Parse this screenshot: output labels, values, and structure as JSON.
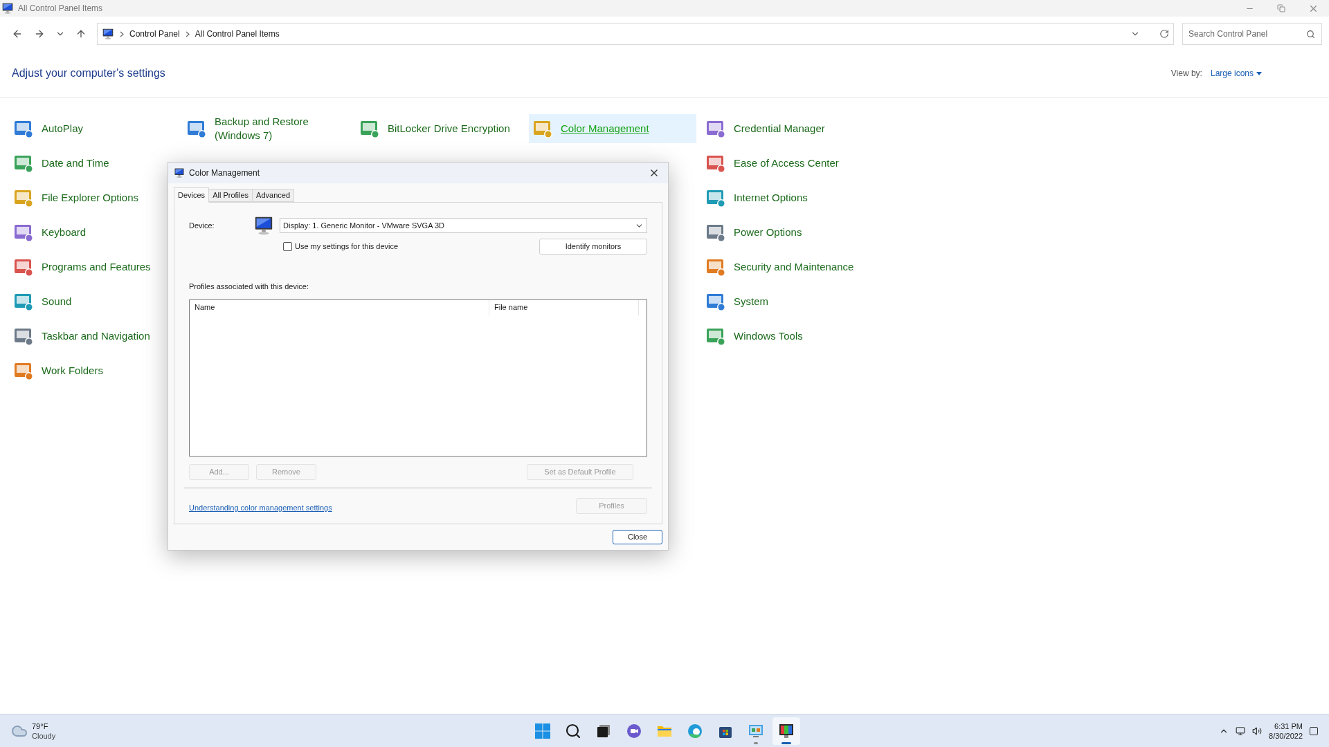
{
  "window": {
    "title": "All Control Panel Items"
  },
  "nav": {
    "breadcrumbs": [
      "Control Panel",
      "All Control Panel Items"
    ],
    "search": {
      "placeholder": "Search Control Panel"
    }
  },
  "heading": "Adjust your computer's settings",
  "view_by": {
    "label": "View by:",
    "value": "Large icons"
  },
  "columns": [
    [
      {
        "label": "AutoPlay",
        "selected": false
      },
      {
        "label": "Date and Time",
        "selected": false
      },
      {
        "label": "File Explorer Options",
        "selected": false
      },
      {
        "label": "Keyboard",
        "selected": false
      },
      {
        "label": "Programs and Features",
        "selected": false
      },
      {
        "label": "Sound",
        "selected": false
      },
      {
        "label": "Taskbar and Navigation",
        "selected": false
      },
      {
        "label": "Work Folders",
        "selected": false
      }
    ],
    [
      {
        "label": "Backup and Restore (Windows 7)",
        "selected": false
      }
    ],
    [
      {
        "label": "BitLocker Drive Encryption",
        "selected": false
      }
    ],
    [
      {
        "label": "Color Management",
        "selected": true
      }
    ],
    [
      {
        "label": "Credential Manager",
        "selected": false
      },
      {
        "label": "Ease of Access Center",
        "selected": false
      },
      {
        "label": "Internet Options",
        "selected": false
      },
      {
        "label": "Power Options",
        "selected": false
      },
      {
        "label": "Security and Maintenance",
        "selected": false
      },
      {
        "label": "System",
        "selected": false
      },
      {
        "label": "Windows Tools",
        "selected": false
      }
    ]
  ],
  "dialog": {
    "title": "Color Management",
    "tabs": [
      {
        "label": "Devices",
        "selected": true
      },
      {
        "label": "All Profiles",
        "selected": false
      },
      {
        "label": "Advanced",
        "selected": false
      }
    ],
    "device_label": "Device:",
    "device_value": "Display: 1. Generic Monitor - VMware SVGA 3D",
    "use_my_settings": {
      "label": "Use my settings for this device",
      "checked": false
    },
    "identify_button": "Identify monitors",
    "profiles_label": "Profiles associated with this device:",
    "table": {
      "columns": [
        "Name",
        "File name"
      ]
    },
    "buttons": [
      {
        "label": "Add...",
        "disabled": true
      },
      {
        "label": "Remove",
        "disabled": true
      },
      {
        "label": "Set as Default Profile",
        "disabled": true
      }
    ],
    "link": "Understanding color management settings",
    "profiles_button": {
      "label": "Profiles",
      "disabled": true
    },
    "close_button": "Close"
  },
  "taskbar": {
    "weather": {
      "temperature": "79°F",
      "condition": "Cloudy"
    },
    "apps": [
      {
        "kind": "start",
        "selected": false
      },
      {
        "kind": "search",
        "selected": false
      },
      {
        "kind": "taskview",
        "selected": false
      },
      {
        "kind": "chat",
        "selected": false
      },
      {
        "kind": "explorer",
        "selected": false
      },
      {
        "kind": "edge",
        "selected": false
      },
      {
        "kind": "store",
        "selected": false
      },
      {
        "kind": "controlpanel",
        "selected": false,
        "running": true
      },
      {
        "kind": "colormgmt",
        "selected": true,
        "running": true
      }
    ],
    "time": "6:31 PM",
    "date": "8/30/2022"
  }
}
